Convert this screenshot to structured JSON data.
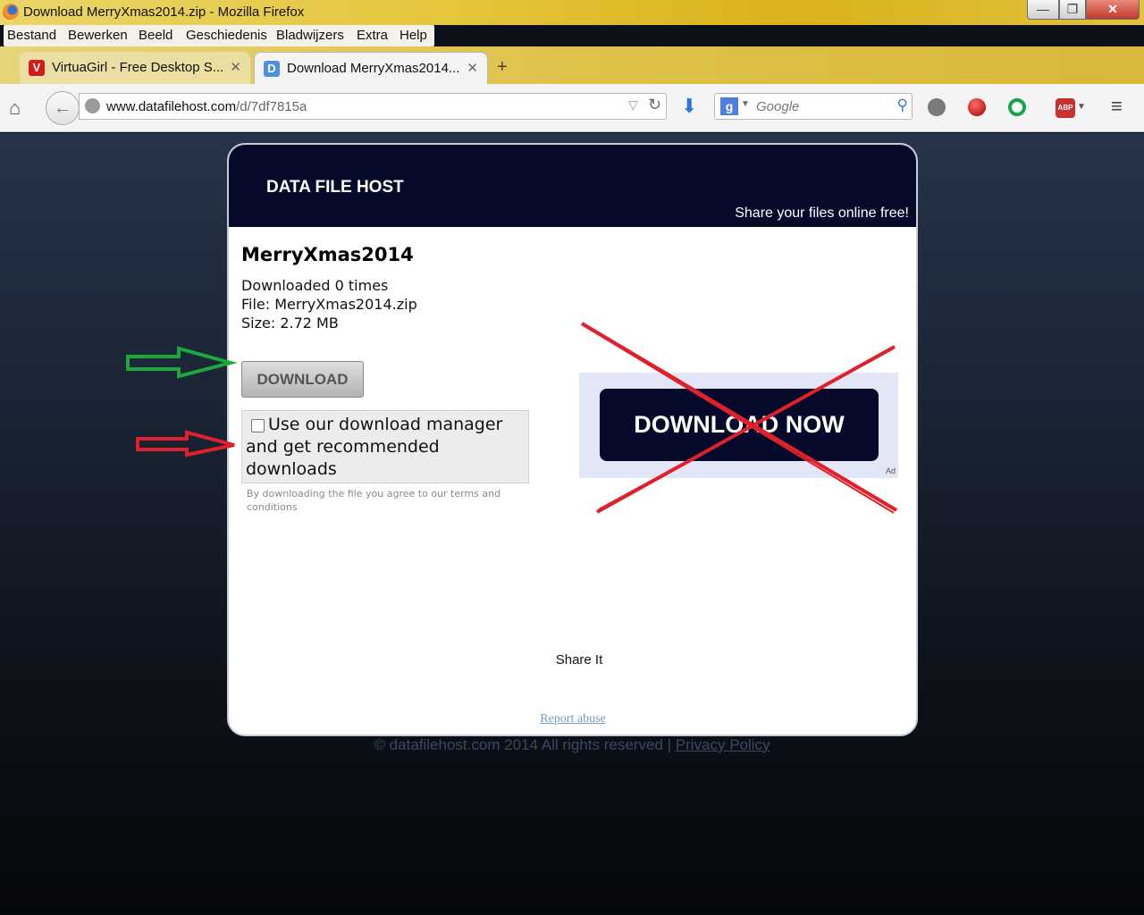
{
  "window": {
    "title": "Download MerryXmas2014.zip - Mozilla Firefox",
    "controls": {
      "minimize": "—",
      "maximize": "❐",
      "close": "✕"
    }
  },
  "menubar": [
    "Bestand",
    "Bewerken",
    "Beeld",
    "Geschiedenis",
    "Bladwijzers",
    "Extra",
    "Help"
  ],
  "tabs": [
    {
      "label": "VirtuaGirl - Free Desktop S...",
      "favicon": "V",
      "icon": "virtuagirl-favicon",
      "active": false
    },
    {
      "label": "Download MerryXmas2014...",
      "favicon": "D",
      "icon": "datafilehost-favicon",
      "active": true
    }
  ],
  "navbar": {
    "url_domain": "www.datafilehost.com",
    "url_path": "/d/7df7815a",
    "search_placeholder": "Google",
    "search_engine_letter": "g"
  },
  "page": {
    "site_name": "DATA FILE HOST",
    "tagline": "Share your files online free!",
    "file_title": "MerryXmas2014",
    "downloaded": "Downloaded 0 times",
    "file": "File: MerryXmas2014.zip",
    "size": "Size: 2.72 MB",
    "download_button": "DOWNLOAD",
    "download_manager_text": "Use our download manager and get recommended downloads",
    "download_manager_checked": false,
    "terms": "By downloading the file you agree to our terms and conditions",
    "ad_button": "DOWNLOAD NOW",
    "ad_label": "Ad",
    "share": "Share It",
    "report": "Report abuse",
    "footer_text": "© datafilehost.com 2014 All rights reserved |",
    "footer_link": "Privacy Policy"
  },
  "colors": {
    "header_navy": "#050a2a",
    "green_arrow": "#1fa83a",
    "red_arrow": "#e0202a",
    "red_cross": "#e0202a"
  }
}
